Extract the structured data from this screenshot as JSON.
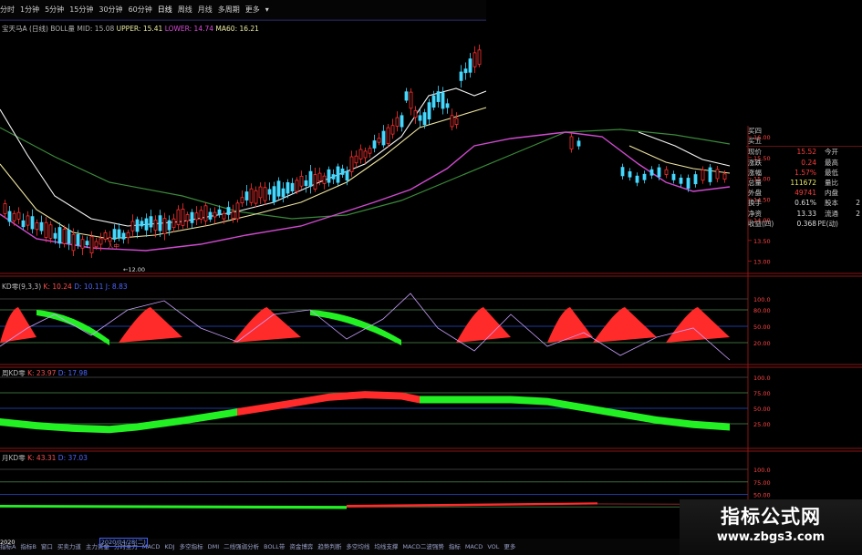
{
  "toolbar": {
    "items": [
      "分时",
      "1分钟",
      "5分钟",
      "15分钟",
      "30分钟",
      "60分钟",
      "日线",
      "周线",
      "月线",
      "多周期",
      "更多"
    ],
    "selected": "日线",
    "more_glyph": "▾"
  },
  "main_header": {
    "stock": "宝天马A (日线)",
    "boll": "BOLL量 MID: 15.08",
    "upper": "UPPER: 15.41",
    "lower": "LOWER: 14.74",
    "ma": "MA60: 16.21"
  },
  "kd_header": {
    "name": "KD零(9,3,3)",
    "k": "K: 10.24",
    "d": "D: 10.11",
    "j": "J: 8.83"
  },
  "week_header": {
    "name": "周KD零",
    "k": "K: 23.97",
    "d": "D: 17.98"
  },
  "month_header": {
    "name": "月KD零",
    "k": "K: 43.31",
    "d": "D: 37.03"
  },
  "annotations": {
    "low_price": "12.00",
    "low_mark": "人中"
  },
  "price_axis": [
    "16.00",
    "15.50",
    "15.00",
    "14.50",
    "14.00",
    "13.50",
    "13.00"
  ],
  "kd_axis": [
    "100.0",
    "80.00",
    "50.00",
    "20.00"
  ],
  "week_axis": [
    "100.0",
    "75.00",
    "50.00",
    "25.00"
  ],
  "month_axis": [
    "100.0",
    "75.00",
    "50.00",
    "25.00"
  ],
  "quote": {
    "top": [
      "买四",
      "买五"
    ],
    "rows": [
      {
        "l": "现价",
        "v": "15.52",
        "c": "r",
        "l2": "今开"
      },
      {
        "l": "涨跌",
        "v": "0.24",
        "c": "r",
        "l2": "最高"
      },
      {
        "l": "涨幅",
        "v": "1.57%",
        "c": "r",
        "l2": "最低"
      },
      {
        "l": "总量",
        "v": "111672",
        "c": "yl",
        "l2": "量比"
      },
      {
        "l": "外盘",
        "v": "49741",
        "c": "r",
        "l2": "内盘"
      },
      {
        "l": "换手",
        "v": "0.61%",
        "c": "wt",
        "l2": "股本"
      },
      {
        "l": "净资",
        "v": "13.33",
        "c": "wt",
        "l2": "流通"
      },
      {
        "l": "收益(四)",
        "v": "0.368",
        "c": "wt",
        "l2": "PE(动)"
      }
    ],
    "side": [
      "2",
      "2"
    ]
  },
  "bottom": {
    "date_prefix": "2020",
    "date_selected": "2020/04/28(二)",
    "tabs": [
      "指标A",
      "指标B",
      "窗口",
      "买卖力道",
      "主力资金",
      "分时主力",
      "MACD",
      "KDJ",
      "多空指标",
      "DMI",
      "二线强弱分析",
      "BOLL带",
      "资金博弈",
      "趋势判断",
      "多空均线",
      "均线支撑",
      "MACD二波强势",
      "指标",
      "MACD",
      "VOL",
      "更多"
    ]
  },
  "watermark": {
    "title": "指标公式网",
    "url": "www.zbgs3.com"
  },
  "colors": {
    "up": "#ff2a2a",
    "down": "#22f022",
    "boll_mid": "#f0e6a0",
    "boll_lower": "#d04ad0",
    "ma60": "#3a8a3a",
    "kd_line": "#c9a0ff"
  }
}
